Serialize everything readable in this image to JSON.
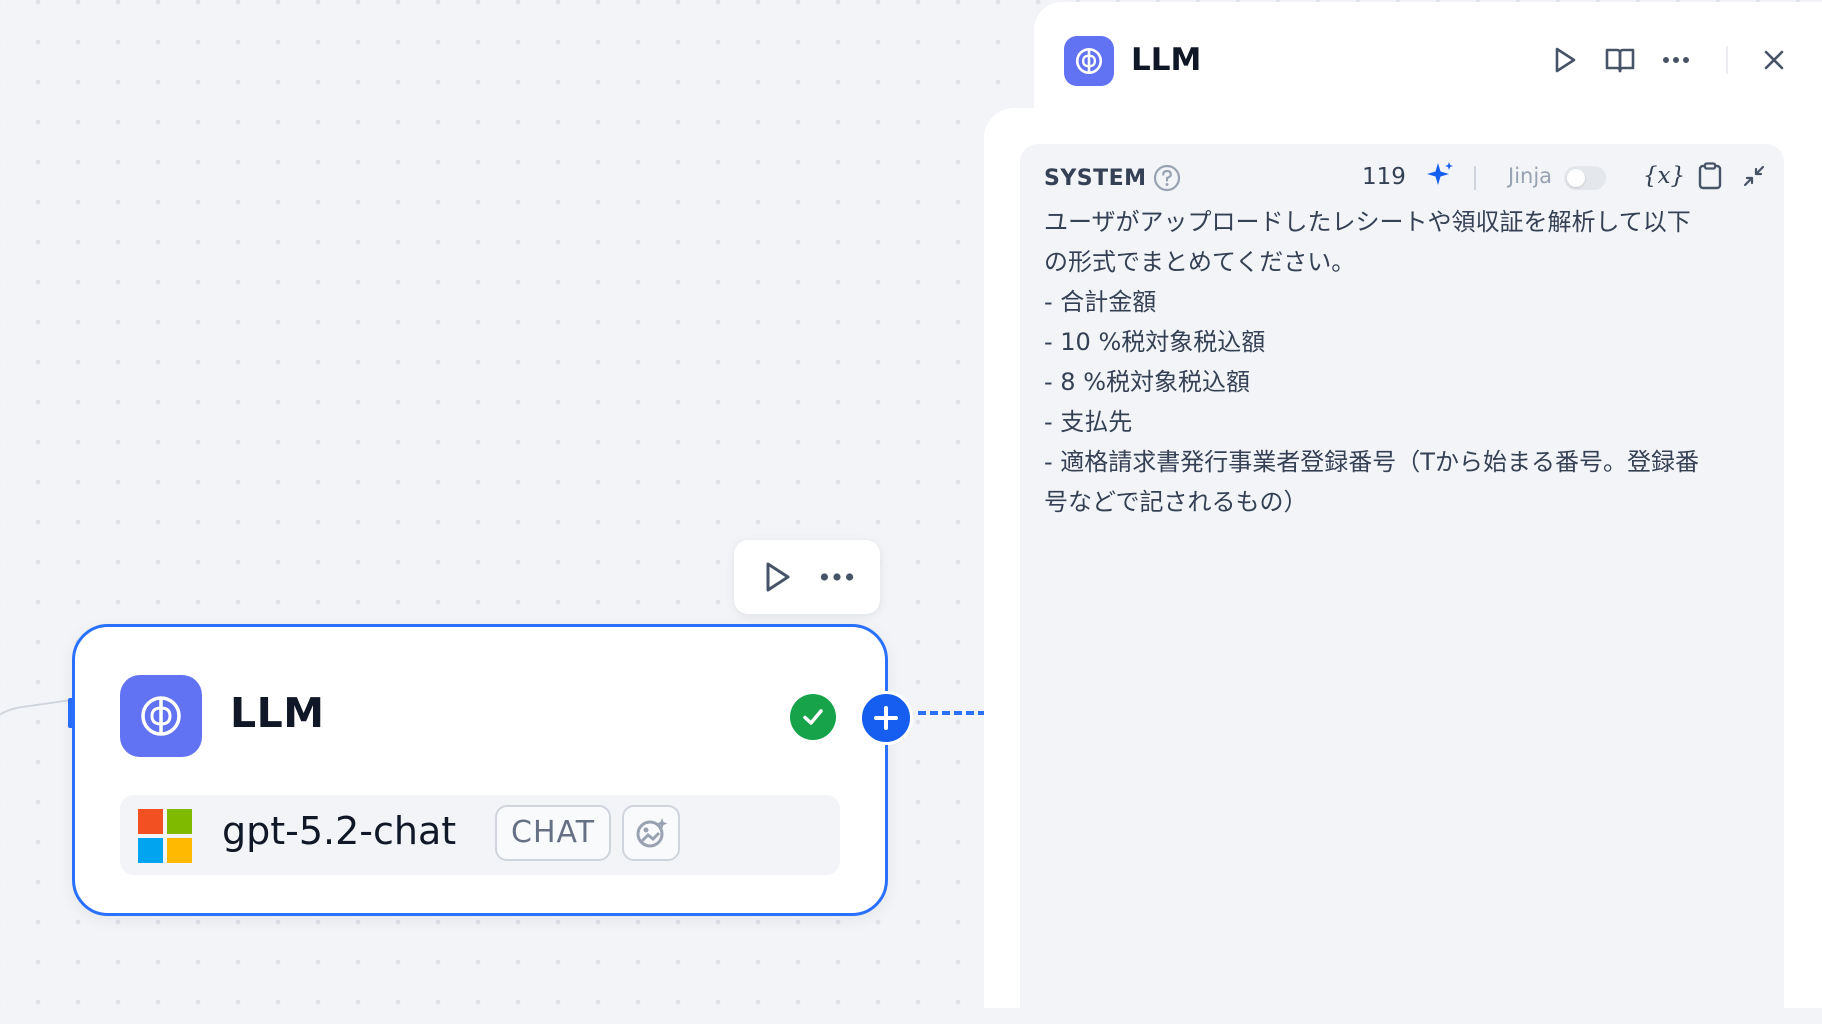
{
  "canvas": {
    "accent_color": "#2970ff",
    "node": {
      "title": "LLM",
      "icon": "brain-icon",
      "icon_bg": "#6172f3",
      "status": "success-check-icon",
      "model": {
        "provider_icon": "microsoft-logo-icon",
        "name": "gpt-5.2-chat",
        "mode_badge": "CHAT",
        "feature_icon": "vision-icon"
      }
    },
    "toolbar": {
      "run_icon": "play-icon",
      "more_icon": "more-horizontal-icon"
    }
  },
  "panel": {
    "title": "LLM",
    "icon": "brain-icon",
    "actions": [
      "play-icon",
      "book-icon",
      "more-horizontal-icon",
      "close-icon"
    ],
    "system_prompt": {
      "label": "SYSTEM",
      "token_count": "119",
      "jinja_label": "Jinja",
      "jinja_enabled": false,
      "variable_button": "{x}",
      "text": "ユーザがアップロードしたレシートや領収証を解析して以下\nの形式でまとめてください。\n- 合計金額\n- 10 %税対象税込額\n- 8 %税対象税込額\n- 支払先\n- 適格請求書発行事業者登録番号（Tから始まる番号。登録番\n号などで記されるもの）"
    }
  }
}
